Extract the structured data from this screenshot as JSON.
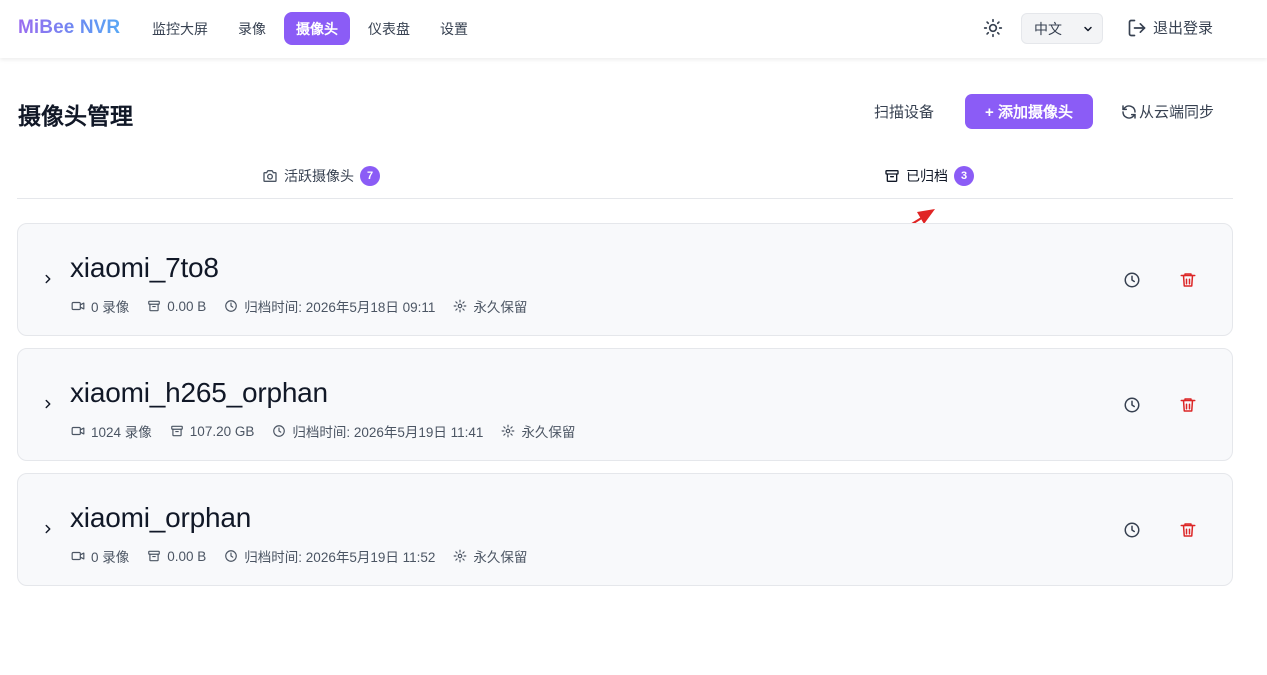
{
  "app": {
    "brand": "MiBee NVR",
    "nav": [
      {
        "label": "监控大屏",
        "active": false
      },
      {
        "label": "录像",
        "active": false
      },
      {
        "label": "摄像头",
        "active": true
      },
      {
        "label": "仪表盘",
        "active": false
      },
      {
        "label": "设置",
        "active": false
      }
    ],
    "language": "中文",
    "logout_label": "退出登录",
    "accent_color": "#8b5cf6"
  },
  "page": {
    "title": "摄像头管理",
    "scan_label": "扫描设备",
    "add_label": "+ 添加摄像头",
    "sync_label": "从云端同步"
  },
  "tabs": [
    {
      "label": "活跃摄像头",
      "count": "7",
      "icon": "camera-icon"
    },
    {
      "label": "已归档",
      "count": "3",
      "icon": "archive-icon",
      "selected": true
    }
  ],
  "cameras": [
    {
      "name": "xiaomi_7to8",
      "recordings": "0 录像",
      "size": "0.00 B",
      "archived_at": "归档时间: 2026年5月18日 09:11",
      "retention": "永久保留"
    },
    {
      "name": "xiaomi_h265_orphan",
      "recordings": "1024 录像",
      "size": "107.20 GB",
      "archived_at": "归档时间: 2026年5月19日 11:41",
      "retention": "永久保留"
    },
    {
      "name": "xiaomi_orphan",
      "recordings": "0 录像",
      "size": "0.00 B",
      "archived_at": "归档时间: 2026年5月19日 11:52",
      "retention": "永久保留"
    }
  ],
  "annotation": {
    "color": "#e02424",
    "icon": "red-arrow"
  }
}
